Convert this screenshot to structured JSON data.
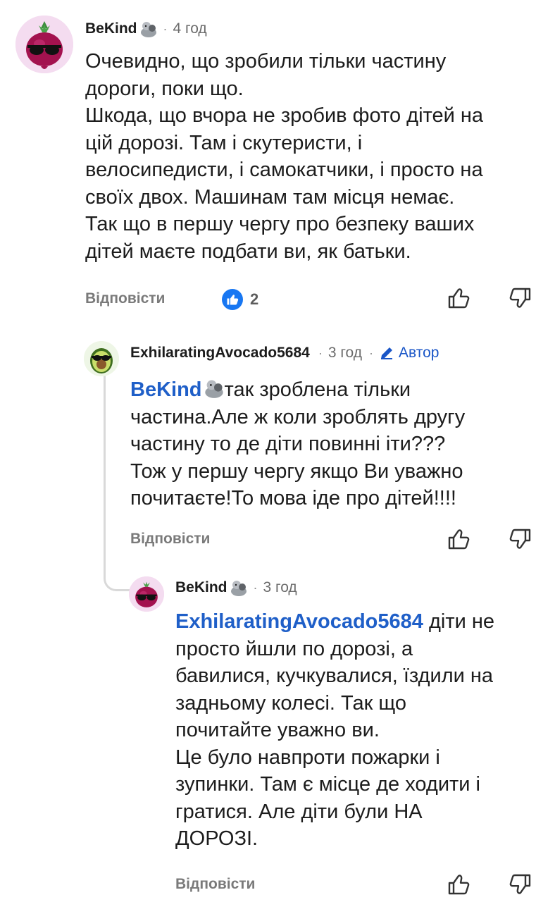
{
  "comments": [
    {
      "username": "BeKind",
      "separator": "·",
      "time": "4 год",
      "body": "Очевидно, що зробили тільки частину\nдороги, поки що.\nШкода, що вчора не зробив фото дітей на\nцій дорозі. Там і скутеристи, і\nвелосипедисти, і самокатчики, і просто на\nсвоїх двох. Машинам там місця немає.\nТак що в першу чергу про безпеку ваших\nдітей маєте подбати ви, як батьки.",
      "reply_label": "Відповісти",
      "reaction_count": "2"
    },
    {
      "username": "ExhilaratingAvocado5684",
      "separator": "·",
      "time": "3 год",
      "op_label": "Автор",
      "mention": "BeKind",
      "body": "так зроблена тільки\nчастина.Але ж коли зроблять другу\nчастину то де діти повинні іти???\nТож у першу чергу якщо Ви уважно\nпочитаєте!То мова іде про дітей!!!!",
      "reply_label": "Відповісти"
    },
    {
      "username": "BeKind",
      "separator": "·",
      "time": "3 год",
      "mention": "ExhilaratingAvocado5684",
      "body": " діти не\nпросто йшли по дорозі, а\nбавилися, кучкувалися, їздили на\nзадньому колесі. Так що\nпочитайте уважно ви.\nЦе було навпроти пожарки і\nзупинки. Там є місце де ходити і\nгратися. Але діти були НА\nДОРОЗІ.",
      "reply_label": "Відповісти"
    }
  ],
  "colors": {
    "mention": "#1f5fc8",
    "op_badge": "#1a56c7",
    "like_badge": "#1877f2",
    "thread_line": "#d9d9d9",
    "beet_avatar_bg": "#f4dcf0",
    "avocado_avatar_bg": "#eef6e6"
  },
  "icons": {
    "snoo": "snoo-icon",
    "pencil": "pencil-icon",
    "like": "thumbs-up-icon",
    "upvote": "upvote-icon",
    "downvote": "downvote-icon"
  }
}
